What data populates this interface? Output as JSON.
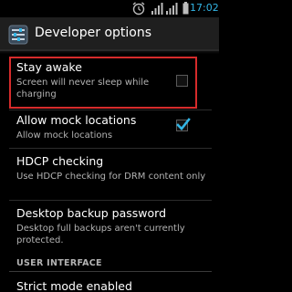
{
  "status_bar": {
    "time": "17:02",
    "icons": [
      "alarm-icon",
      "signal-icon",
      "signal-icon",
      "battery-icon"
    ],
    "accent": "#33b5e5"
  },
  "action_bar": {
    "title": "Developer options",
    "icon": "settings-app-icon"
  },
  "items": [
    {
      "title": "Stay awake",
      "summary": "Screen will never sleep while charging",
      "checkbox": true,
      "checked": false,
      "highlighted": true
    },
    {
      "title": "Allow mock locations",
      "summary": "Allow mock locations",
      "checkbox": true,
      "checked": true
    },
    {
      "title": "HDCP checking",
      "summary": "Use HDCP checking for DRM content only",
      "checkbox": false
    },
    {
      "title": "Desktop backup password",
      "summary": "Desktop full backups aren't currently protected.",
      "checkbox": false
    }
  ],
  "section": {
    "header": "USER INTERFACE"
  },
  "last_item": {
    "title": "Strict mode enabled"
  },
  "colors": {
    "highlight_border": "#d62b2b",
    "check_color": "#33b5e5"
  }
}
